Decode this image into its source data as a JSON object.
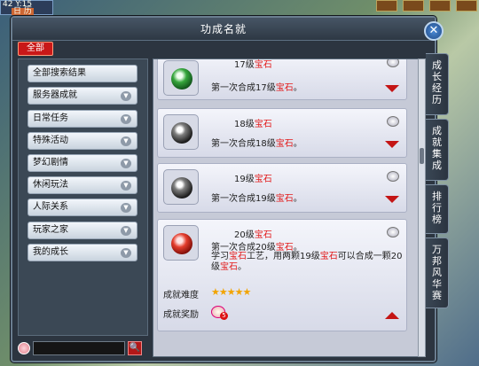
{
  "hud": {
    "time": "42 Y:15",
    "day": "日 历"
  },
  "window": {
    "title": "功成名就",
    "close": "✕"
  },
  "all_tab": "全部",
  "categories": [
    {
      "label": "全部搜索结果",
      "has_arrow": false
    },
    {
      "label": "服务器成就",
      "has_arrow": true
    },
    {
      "label": "日常任务",
      "has_arrow": true
    },
    {
      "label": "特殊活动",
      "has_arrow": true
    },
    {
      "label": "梦幻剧情",
      "has_arrow": true
    },
    {
      "label": "休闲玩法",
      "has_arrow": true
    },
    {
      "label": "人际关系",
      "has_arrow": true
    },
    {
      "label": "玩家之家",
      "has_arrow": true
    },
    {
      "label": "我的成长",
      "has_arrow": true
    }
  ],
  "category_arrow": "▼",
  "search": {
    "value": "",
    "button": "🔍"
  },
  "items": [
    {
      "level": "17级",
      "gem": "宝石",
      "desc_pre": "第一次合成17级",
      "desc_gem": "宝石",
      "desc_post": "。",
      "gem_color": "green"
    },
    {
      "level": "18级",
      "gem": "宝石",
      "desc_pre": "第一次合成18级",
      "desc_gem": "宝石",
      "desc_post": "。",
      "gem_color": "gray"
    },
    {
      "level": "19级",
      "gem": "宝石",
      "desc_pre": "第一次合成19级",
      "desc_gem": "宝石",
      "desc_post": "。",
      "gem_color": "gray"
    }
  ],
  "expanded": {
    "level": "20级",
    "gem": "宝石",
    "desc_pre": "第一次合成20级",
    "desc_gem": "宝石",
    "desc_post": "。",
    "long_a": "学习",
    "long_b": "宝石",
    "long_c": "工艺，用两颗19级",
    "long_d": "宝石",
    "long_e": "可以合成一颗20级",
    "long_f": "宝石",
    "long_g": "。",
    "difficulty_label": "成就难度",
    "stars": "★★★★★",
    "reward_label": "成就奖励",
    "reward_count": "5"
  },
  "side_tabs": [
    "成长经历",
    "成就集成",
    "排行榜",
    "万邦风华赛"
  ]
}
